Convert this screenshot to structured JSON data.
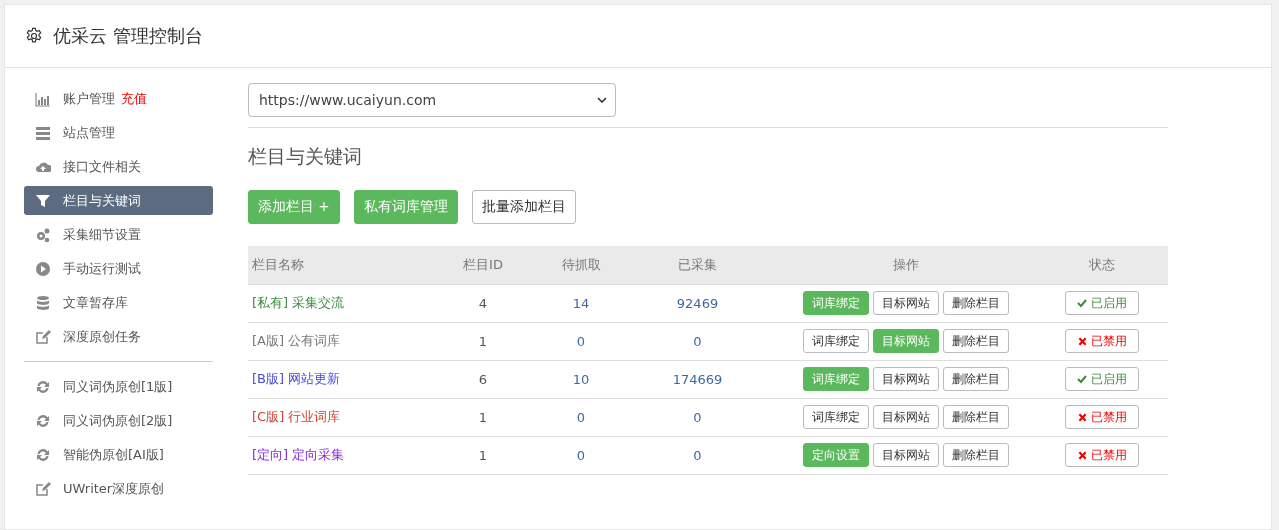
{
  "header": {
    "title": "优采云 管理控制台"
  },
  "sidebar": {
    "items": [
      {
        "label": "账户管理",
        "extra": "充值",
        "selected": false
      },
      {
        "label": "站点管理",
        "selected": false
      },
      {
        "label": "接口文件相关",
        "selected": false
      },
      {
        "label": "栏目与关键词",
        "selected": true
      },
      {
        "label": "采集细节设置",
        "selected": false
      },
      {
        "label": "手动运行测试",
        "selected": false
      },
      {
        "label": "文章暂存库",
        "selected": false
      },
      {
        "label": "深度原创任务",
        "selected": false
      }
    ],
    "items_2": [
      {
        "label": "同义词伪原创[1版]",
        "selected": false
      },
      {
        "label": "同义词伪原创[2版]",
        "selected": false
      },
      {
        "label": "智能伪原创[AI版]",
        "selected": false
      },
      {
        "label": "UWriter深度原创",
        "selected": false
      }
    ]
  },
  "site_select": {
    "value": "https://www.ucaiyun.com"
  },
  "section_title": "栏目与关键词",
  "toolbar": [
    {
      "label": "添加栏目 +",
      "primary": true
    },
    {
      "label": "私有词库管理",
      "primary": true
    },
    {
      "label": "批量添加栏目",
      "primary": false
    }
  ],
  "table": {
    "columns": [
      "栏目名称",
      "栏目ID",
      "待抓取",
      "已采集",
      "操作",
      "状态"
    ],
    "rows": [
      {
        "tag": "[私有]",
        "name": "采集交流",
        "color": "#3c8a3c",
        "id": "4",
        "pending": "14",
        "collected": "92469",
        "actions": [
          {
            "label": "词库绑定",
            "primary": true
          },
          {
            "label": "目标网站",
            "primary": false
          },
          {
            "label": "删除栏目",
            "primary": false
          }
        ],
        "status": "已启用",
        "enabled": true
      },
      {
        "tag": "[A版]",
        "name": "公有词库",
        "color": "#777777",
        "id": "1",
        "pending": "0",
        "collected": "0",
        "actions": [
          {
            "label": "词库绑定",
            "primary": false
          },
          {
            "label": "目标网站",
            "primary": true
          },
          {
            "label": "删除栏目",
            "primary": false
          }
        ],
        "status": "已禁用",
        "enabled": false
      },
      {
        "tag": "[B版]",
        "name": "网站更新",
        "color": "#4a4ad8",
        "id": "6",
        "pending": "10",
        "collected": "174669",
        "actions": [
          {
            "label": "词库绑定",
            "primary": true
          },
          {
            "label": "目标网站",
            "primary": false
          },
          {
            "label": "删除栏目",
            "primary": false
          }
        ],
        "status": "已启用",
        "enabled": true
      },
      {
        "tag": "[C版]",
        "name": "行业词库",
        "color": "#d2432f",
        "id": "1",
        "pending": "0",
        "collected": "0",
        "actions": [
          {
            "label": "词库绑定",
            "primary": false
          },
          {
            "label": "目标网站",
            "primary": false
          },
          {
            "label": "删除栏目",
            "primary": false
          }
        ],
        "status": "已禁用",
        "enabled": false
      },
      {
        "tag": "[定向]",
        "name": "定向采集",
        "color": "#8a2be2",
        "id": "1",
        "pending": "0",
        "collected": "0",
        "actions": [
          {
            "label": "定向设置",
            "primary": true
          },
          {
            "label": "目标网站",
            "primary": false
          },
          {
            "label": "删除栏目",
            "primary": false
          }
        ],
        "status": "已禁用",
        "enabled": false
      }
    ]
  }
}
